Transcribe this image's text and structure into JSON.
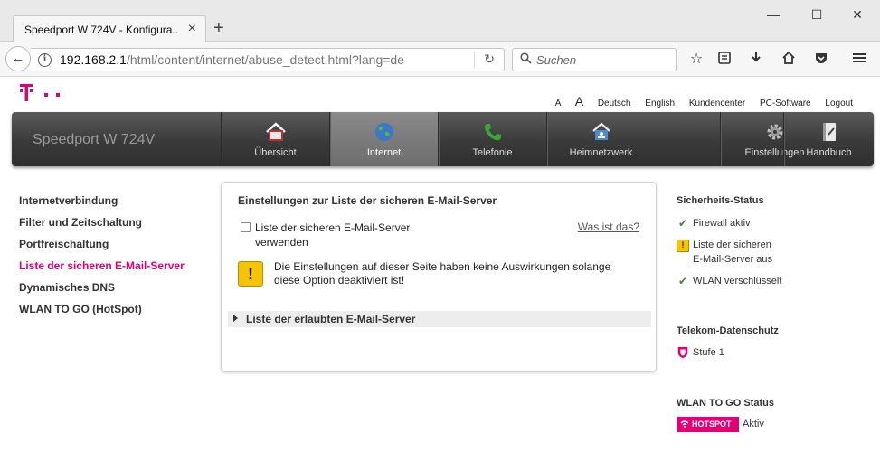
{
  "browser": {
    "tab_title": "Speedport W 724V - Konfigura...",
    "tab_close": "×",
    "new_tab": "+",
    "url_host": "192.168.2.1",
    "url_path": "/html/content/internet/abuse_detect.html?lang=de",
    "search_placeholder": "Suchen",
    "window": {
      "minimize": "—",
      "maximize": "☐",
      "close": "✕"
    }
  },
  "header": {
    "font_small": "A",
    "font_large": "A",
    "links": [
      "Deutsch",
      "English",
      "Kundencenter",
      "PC-Software",
      "Logout"
    ]
  },
  "mainnav": {
    "brand": "Speedport W 724V",
    "items": [
      {
        "label": "Übersicht",
        "icon": "home-icon"
      },
      {
        "label": "Internet",
        "icon": "globe-icon",
        "active": true
      },
      {
        "label": "Telefonie",
        "icon": "phone-icon"
      },
      {
        "label": "Heimnetzwerk",
        "icon": "network-icon"
      },
      {
        "label": "Einstellungen",
        "icon": "gear-icon"
      },
      {
        "label": "Handbuch",
        "icon": "book-icon"
      }
    ]
  },
  "sidebar": {
    "items": [
      {
        "label": "Internetverbindung"
      },
      {
        "label": "Filter und Zeitschaltung"
      },
      {
        "label": "Portfreischaltung"
      },
      {
        "label": "Liste der sicheren E-Mail-Server",
        "active": true
      },
      {
        "label": "Dynamisches DNS"
      },
      {
        "label": "WLAN TO GO (HotSpot)"
      }
    ]
  },
  "panel": {
    "title": "Einstellungen zur Liste der sicheren E-Mail-Server",
    "checkbox_label_1": "Liste der sicheren E-Mail-Server",
    "checkbox_label_2": "verwenden",
    "checkbox_checked": false,
    "help_link": "Was ist das?",
    "warning_glyph": "!",
    "warning_line_1": "Die Einstellungen auf dieser Seite haben keine Auswirkungen solange",
    "warning_line_2": "diese Option deaktiviert ist!",
    "accordion_label": "Liste der erlaubten E-Mail-Server"
  },
  "status": {
    "security_title": "Sicherheits-Status",
    "firewall": "Firewall aktiv",
    "mailserver_1": "Liste der sicheren",
    "mailserver_2": "E-Mail-Server aus",
    "wlan": "WLAN verschlüsselt",
    "privacy_title": "Telekom-Datenschutz",
    "privacy_level": "Stufe 1",
    "hotspot_title": "WLAN TO GO Status",
    "hotspot_badge": "HOTSPOT",
    "hotspot_state": "Aktiv"
  },
  "colors": {
    "brand_magenta": "#e20074",
    "nav_dark": "#3a3a3a",
    "check_green": "#3a8d2d",
    "warning_yellow": "#f6c400"
  }
}
